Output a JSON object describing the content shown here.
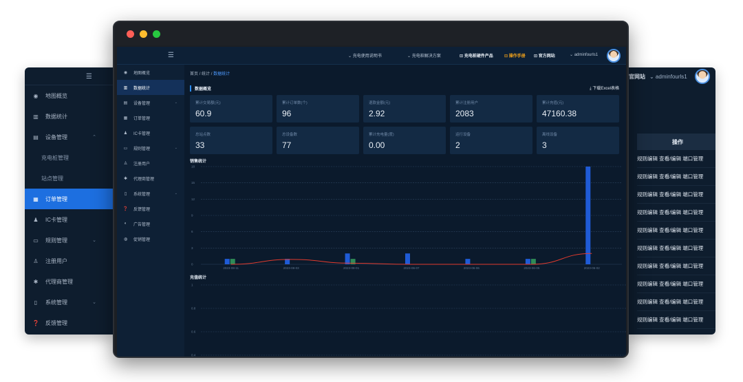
{
  "bg_left": {
    "fold_icon": "☰",
    "items": [
      {
        "label": "地图概览",
        "icon": "map-icon",
        "glyph": "◉"
      },
      {
        "label": "数据统计",
        "icon": "stats-icon",
        "glyph": "▥"
      },
      {
        "label": "设备管理",
        "icon": "device-icon",
        "glyph": "▤",
        "arrow": "⌃"
      },
      {
        "label": "充电桩管理",
        "sub": true
      },
      {
        "label": "站点管理",
        "sub": true
      },
      {
        "label": "订单管理",
        "icon": "order-icon",
        "glyph": "▦",
        "active": true
      },
      {
        "label": "IC卡管理",
        "icon": "card-icon",
        "glyph": "♟"
      },
      {
        "label": "规则管理",
        "icon": "rule-icon",
        "glyph": "▭",
        "arrow": "⌄"
      },
      {
        "label": "注册用户",
        "icon": "user-icon",
        "glyph": "♙"
      },
      {
        "label": "代理商管理",
        "icon": "agent-icon",
        "glyph": "✱"
      },
      {
        "label": "系统管理",
        "icon": "system-icon",
        "glyph": "▯",
        "arrow": "⌄"
      },
      {
        "label": "反馈管理",
        "icon": "feedback-icon",
        "glyph": "❓"
      }
    ]
  },
  "bg_right": {
    "site_link": "官网站",
    "user": "⌄ adminfourls1",
    "op_header": "操作",
    "op_row": "规则编辑 查看/编辑 端口管理",
    "rows": 10
  },
  "topbar": {
    "fold_icon": "☰",
    "menus": [
      {
        "label": "⌄ 充电使用说明书",
        "style": "n"
      },
      {
        "label": "⌄ 充电桩解决方案",
        "style": "n"
      },
      {
        "label": "⊡ 充电桩硬件产品",
        "style": "b"
      },
      {
        "label": "⊡ 操作手册",
        "style": "o"
      },
      {
        "label": "⊡ 官方网站",
        "style": "b"
      },
      {
        "label": "⌄ adminfourls1",
        "style": "n"
      }
    ]
  },
  "sidebar": {
    "items": [
      {
        "label": "地图概览",
        "glyph": "◉"
      },
      {
        "label": "数据统计",
        "glyph": "▥",
        "active": true
      },
      {
        "label": "设备管理",
        "glyph": "▤",
        "arrow": "⌄"
      },
      {
        "label": "订单管理",
        "glyph": "▦"
      },
      {
        "label": "IC卡管理",
        "glyph": "♟"
      },
      {
        "label": "规则管理",
        "glyph": "▭",
        "arrow": "⌄"
      },
      {
        "label": "注册用户",
        "glyph": "♙"
      },
      {
        "label": "代理商管理",
        "glyph": "✱"
      },
      {
        "label": "系统管理",
        "glyph": "▯",
        "arrow": "⌄"
      },
      {
        "label": "反馈管理",
        "glyph": "❓"
      },
      {
        "label": "广告管理",
        "glyph": "◐"
      },
      {
        "label": "促销管理",
        "glyph": "◍"
      }
    ]
  },
  "breadcrumb": {
    "home": "首页",
    "sep": "/",
    "mid": "统计",
    "current": "数据统计"
  },
  "overview": {
    "title": "数据概览",
    "download": "⤓ 下载Excel表格",
    "cards": [
      {
        "label": "累计交易额(元)",
        "value": "60.9"
      },
      {
        "label": "累计订单数(个)",
        "value": "96"
      },
      {
        "label": "退款金额(元)",
        "value": "2.92"
      },
      {
        "label": "累计注册用户",
        "value": "2083"
      },
      {
        "label": "累计充值(元)",
        "value": "47160.38"
      },
      {
        "label": "总站点数",
        "value": "33"
      },
      {
        "label": "总设备数",
        "value": "77"
      },
      {
        "label": "累计充电量(度)",
        "value": "0.00"
      },
      {
        "label": "运行设备",
        "value": "2"
      },
      {
        "label": "离线设备",
        "value": "3"
      }
    ]
  },
  "chart_data": [
    {
      "type": "bar",
      "title": "销售统计",
      "categories": [
        "2023-08-11",
        "2023-08-03",
        "2023-08-01",
        "2023-06-07",
        "2023-06-06",
        "2023-06-05",
        "2023-06-02"
      ],
      "ylim": [
        0,
        18
      ],
      "yticks": [
        0,
        3,
        6,
        9,
        12,
        15,
        18
      ],
      "series": [
        {
          "color": "#1f5bd6",
          "values": [
            1,
            1,
            2,
            2,
            1,
            1,
            18
          ]
        },
        {
          "color": "#2e8b57",
          "values": [
            1,
            0,
            1,
            0,
            0,
            1,
            0
          ]
        }
      ],
      "line": {
        "color": "#e23b2e",
        "values": [
          0,
          0.9,
          0.2,
          0,
          0,
          0,
          2
        ]
      },
      "grid": true
    },
    {
      "type": "line",
      "title": "充值统计",
      "ylim": [
        0.4,
        1
      ],
      "yticks": [
        1,
        0.8,
        0.6,
        0.4
      ],
      "grid": true
    }
  ],
  "colors": {
    "accent": "#2d8cf0",
    "panel": "#0b1a2c",
    "card": "#132a44"
  }
}
